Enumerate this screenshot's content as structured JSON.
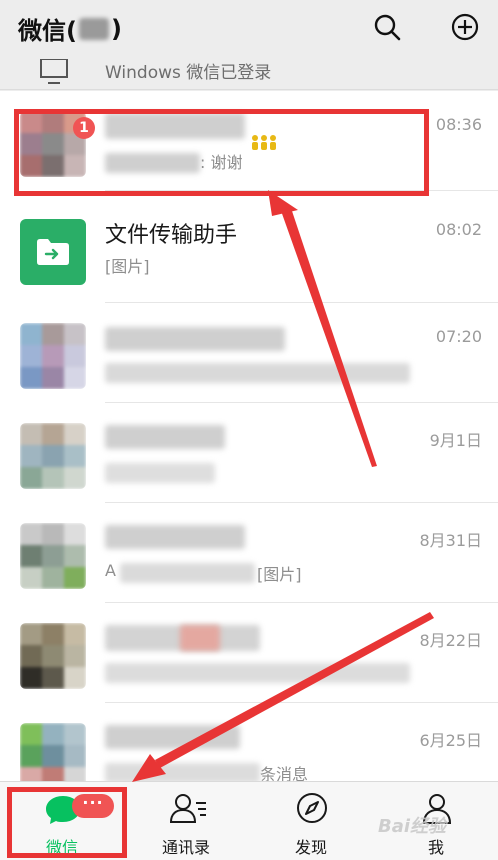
{
  "header": {
    "title_prefix": "微信(",
    "title_suffix": ")"
  },
  "windows_login": {
    "text": "Windows 微信已登录"
  },
  "chats": [
    {
      "name": "",
      "preview_tail": ": 谢谢",
      "time": "08:36",
      "unread": "1"
    },
    {
      "name": "文件传输助手",
      "preview": "[图片]",
      "time": "08:02"
    },
    {
      "name": "",
      "preview": "",
      "time": "07:20"
    },
    {
      "name": "",
      "preview": "",
      "time": "9月1日"
    },
    {
      "name": "",
      "preview_tail": "[图片]",
      "preview_head": "A",
      "time": "8月31日"
    },
    {
      "name": "",
      "preview": "",
      "time": "8月22日"
    },
    {
      "name": "",
      "preview_tail": "条消息",
      "time": "6月25日"
    }
  ],
  "tabbar": {
    "tabs": [
      {
        "label": "微信",
        "badge": "···"
      },
      {
        "label": "通讯录"
      },
      {
        "label": "发现"
      },
      {
        "label": "我"
      }
    ]
  },
  "watermark": "Bai经验",
  "colors": {
    "accent": "#07c160",
    "highlight": "#e83535",
    "badge": "#f05454",
    "background": "#ededed"
  }
}
